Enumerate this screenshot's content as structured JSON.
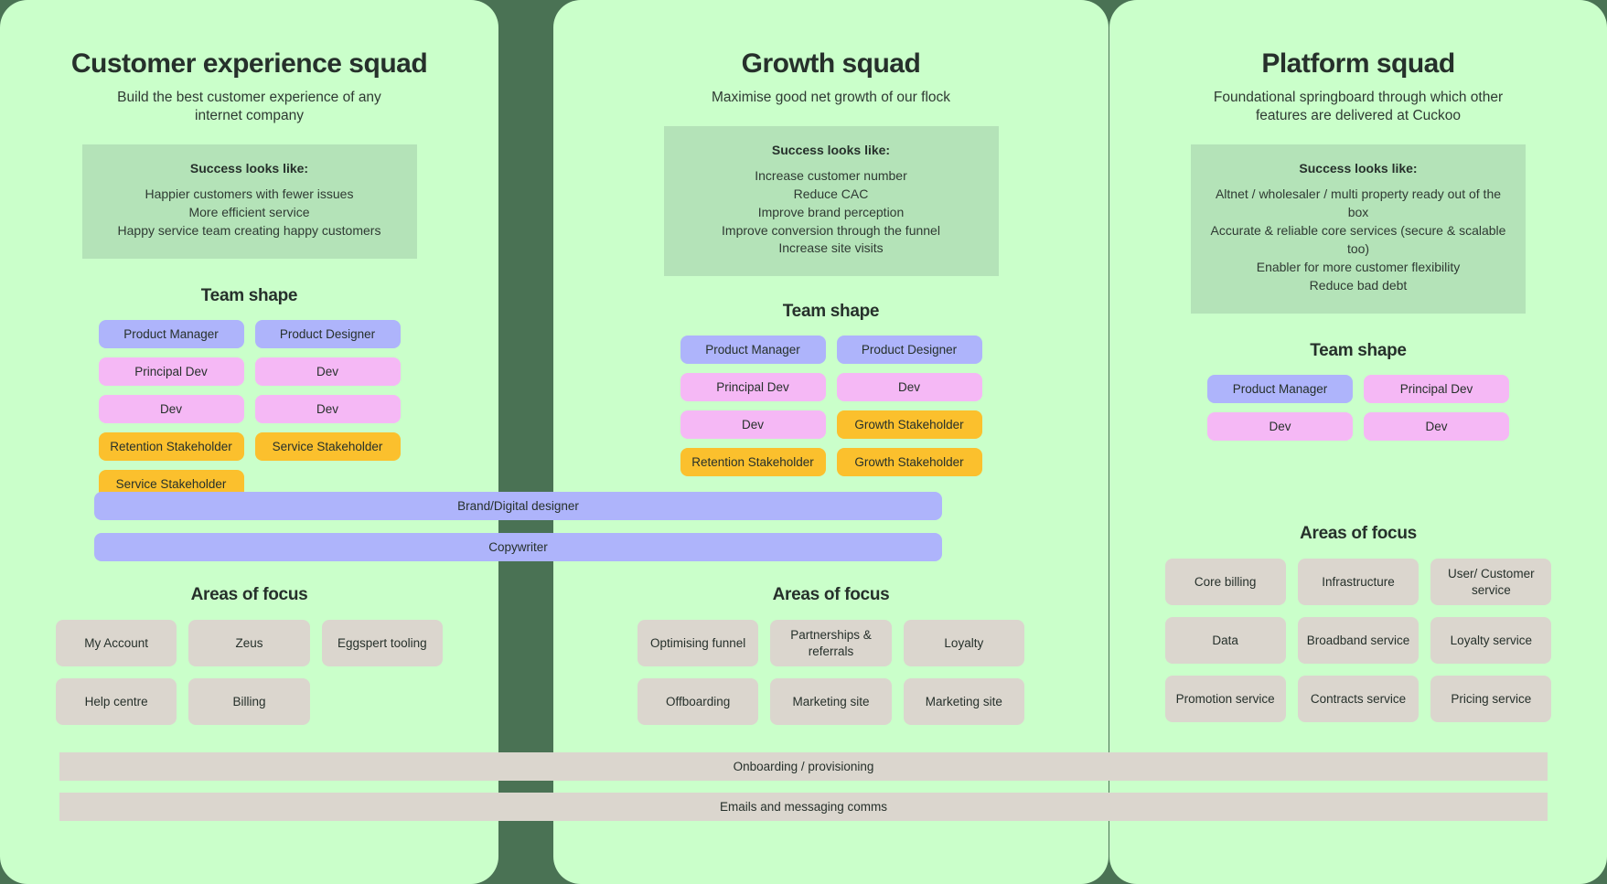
{
  "colors": {
    "page_background": "#4a7254",
    "panel_background": "#caffca",
    "success_box": "#b4e3b8",
    "role_product": "#aeb4fb",
    "role_dev": "#f5b8f5",
    "role_stakeholder": "#fbc02d",
    "focus_card": "#dbd6ce",
    "text": "#26302b"
  },
  "labels": {
    "success_heading": "Success looks like:",
    "team_shape_heading": "Team shape",
    "areas_of_focus_heading": "Areas of focus"
  },
  "columns": [
    {
      "id": "customer-experience-squad",
      "title": "Customer experience squad",
      "subtitle": "Build the best customer experience of any internet company",
      "success_heading": "Success looks like:",
      "success_lines": [
        "Happier customers with fewer issues",
        "More efficient service",
        "Happy service team creating happy customers"
      ],
      "team_shape_heading": "Team shape",
      "team_shape": [
        {
          "label": "Product Manager",
          "role": "product"
        },
        {
          "label": "Product Designer",
          "role": "product"
        },
        {
          "label": "Principal Dev",
          "role": "dev"
        },
        {
          "label": "Dev",
          "role": "dev"
        },
        {
          "label": "Dev",
          "role": "dev"
        },
        {
          "label": "Dev",
          "role": "dev"
        },
        {
          "label": "Retention Stakeholder",
          "role": "stakeholder"
        },
        {
          "label": "Service Stakeholder",
          "role": "stakeholder"
        },
        {
          "label": "Service Stakeholder",
          "role": "stakeholder"
        }
      ],
      "areas_heading": "Areas of focus",
      "areas_of_focus": [
        "My Account",
        "Zeus",
        "Eggspert tooling",
        "Help centre",
        "Billing"
      ]
    },
    {
      "id": "growth-squad",
      "title": "Growth squad",
      "subtitle": "Maximise good net growth of our flock",
      "success_heading": "Success looks like:",
      "success_lines": [
        "Increase customer number",
        "Reduce CAC",
        "Improve brand perception",
        "Improve conversion through the funnel",
        "Increase site visits"
      ],
      "team_shape_heading": "Team shape",
      "team_shape": [
        {
          "label": "Product Manager",
          "role": "product"
        },
        {
          "label": "Product Designer",
          "role": "product"
        },
        {
          "label": "Principal Dev",
          "role": "dev"
        },
        {
          "label": "Dev",
          "role": "dev"
        },
        {
          "label": "Dev",
          "role": "dev"
        },
        {
          "label": "Growth Stakeholder",
          "role": "stakeholder"
        },
        {
          "label": "Retention Stakeholder",
          "role": "stakeholder"
        },
        {
          "label": "Growth Stakeholder",
          "role": "stakeholder"
        }
      ],
      "areas_heading": "Areas of focus",
      "areas_of_focus": [
        "Optimising funnel",
        "Partnerships & referrals",
        "Loyalty",
        "Offboarding",
        "Marketing site",
        "Marketing site"
      ]
    },
    {
      "id": "platform-squad",
      "title": "Platform squad",
      "subtitle": "Foundational springboard through which other features are delivered at Cuckoo",
      "success_heading": "Success looks like:",
      "success_lines": [
        "Altnet / wholesaler / multi property ready out of the box",
        "Accurate & reliable core services (secure & scalable too)",
        "Enabler for more customer flexibility",
        "Reduce bad debt"
      ],
      "team_shape_heading": "Team shape",
      "team_shape": [
        {
          "label": "Product Manager",
          "role": "product"
        },
        {
          "label": "Principal Dev",
          "role": "dev"
        },
        {
          "label": "Dev",
          "role": "dev"
        },
        {
          "label": "Dev",
          "role": "dev"
        }
      ],
      "areas_heading": "Areas of focus",
      "areas_of_focus": [
        "Core billing",
        "Infrastructure",
        "User/ Customer service",
        "Data",
        "Broadband service",
        "Loyalty service",
        "Promotion service",
        "Contracts service",
        "Pricing service"
      ]
    }
  ],
  "shared_roles": [
    {
      "label": "Brand/Digital designer",
      "role": "product"
    },
    {
      "label": "Copywriter",
      "role": "product"
    }
  ],
  "shared_bottom_bars": [
    {
      "label": "Onboarding / provisioning"
    },
    {
      "label": "Emails and messaging comms"
    }
  ]
}
